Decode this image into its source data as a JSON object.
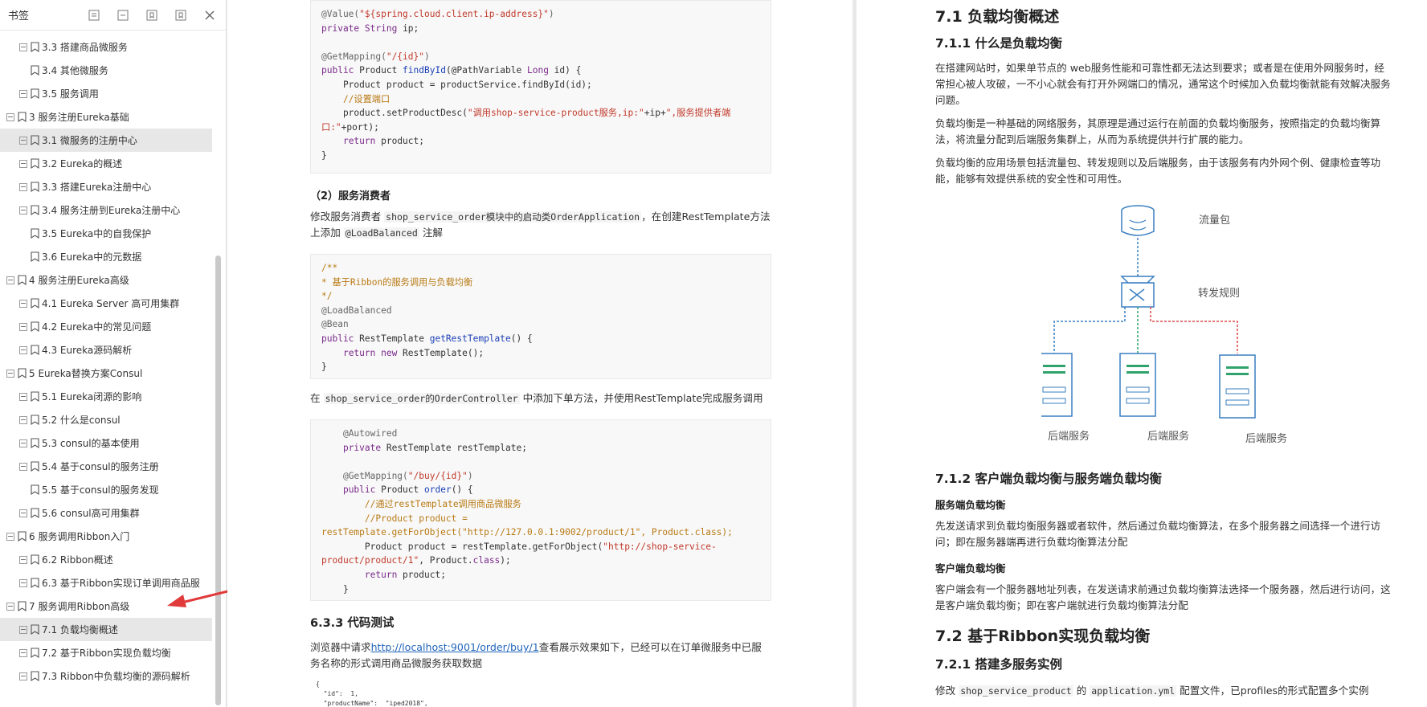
{
  "sidebar": {
    "title": "书签",
    "items": [
      {
        "label": "3.3 搭建商品微服务",
        "level": 2,
        "expand": true
      },
      {
        "label": "3.4 其他微服务",
        "level": 2,
        "expand": false
      },
      {
        "label": "3.5 服务调用",
        "level": 2,
        "expand": true
      },
      {
        "label": "3 服务注册Eureka基础",
        "level": 1,
        "expand": true
      },
      {
        "label": "3.1 微服务的注册中心",
        "level": 2,
        "expand": true,
        "selected": true
      },
      {
        "label": "3.2 Eureka的概述",
        "level": 2,
        "expand": true
      },
      {
        "label": "3.3 搭建Eureka注册中心",
        "level": 2,
        "expand": true
      },
      {
        "label": "3.4 服务注册到Eureka注册中心",
        "level": 2,
        "expand": true
      },
      {
        "label": "3.5 Eureka中的自我保护",
        "level": 2,
        "expand": false
      },
      {
        "label": "3.6 Eureka中的元数据",
        "level": 2,
        "expand": false
      },
      {
        "label": "4 服务注册Eureka高级",
        "level": 1,
        "expand": true
      },
      {
        "label": "4.1 Eureka Server 高可用集群",
        "level": 2,
        "expand": true
      },
      {
        "label": "4.2 Eureka中的常见问题",
        "level": 2,
        "expand": true
      },
      {
        "label": "4.3 Eureka源码解析",
        "level": 2,
        "expand": true
      },
      {
        "label": "5 Eureka替换方案Consul",
        "level": 1,
        "expand": true
      },
      {
        "label": "5.1 Eureka闭源的影响",
        "level": 2,
        "expand": true
      },
      {
        "label": "5.2 什么是consul",
        "level": 2,
        "expand": true
      },
      {
        "label": "5.3 consul的基本使用",
        "level": 2,
        "expand": true
      },
      {
        "label": "5.4 基于consul的服务注册",
        "level": 2,
        "expand": true
      },
      {
        "label": "5.5 基于consul的服务发现",
        "level": 2,
        "expand": false
      },
      {
        "label": "5.6 consul高可用集群",
        "level": 2,
        "expand": true
      },
      {
        "label": "6 服务调用Ribbon入门",
        "level": 1,
        "expand": true
      },
      {
        "label": "6.2 Ribbon概述",
        "level": 2,
        "expand": true
      },
      {
        "label": "6.3 基于Ribbon实现订单调用商品服",
        "level": 2,
        "expand": true
      },
      {
        "label": "7 服务调用Ribbon高级",
        "level": 1,
        "expand": true
      },
      {
        "label": "7.1 负载均衡概述",
        "level": 2,
        "expand": true,
        "selected": true
      },
      {
        "label": "7.2 基于Ribbon实现负载均衡",
        "level": 2,
        "expand": true
      },
      {
        "label": "7.3 Ribbon中负载均衡的源码解析",
        "level": 2,
        "expand": true
      }
    ]
  },
  "left": {
    "code1": [
      [
        "an",
        "@Value(\"${spring.cloud.client.ip-address}\")"
      ],
      [
        "kw",
        "private "
      ],
      [
        "",
        "String ip;"
      ],
      [
        "",
        ""
      ],
      [
        "an",
        "@GetMapping(\"/{id}\")"
      ],
      [
        "kw",
        "public "
      ],
      [
        "",
        "Product "
      ],
      [
        "fn",
        "findById"
      ],
      [
        "",
        "(@PathVariable Long id) {"
      ],
      [
        "",
        "    Product product = productService.findById(id);"
      ],
      [
        "cm",
        "    //设置端口"
      ],
      [
        "",
        "    product.setProductDesc(\"调用shop-service-product服务,ip:\"+ip+\",服务提供者端"
      ],
      [
        "",
        "口:\"+port);"
      ],
      [
        "kw",
        "    return "
      ],
      [
        "",
        "product;"
      ],
      [
        "",
        "}"
      ]
    ],
    "code1_lines": [
      "@Value(\"${spring.cloud.client.ip-address}\")",
      "private String ip;",
      "",
      "@GetMapping(\"/{id}\")",
      "public Product findById(@PathVariable Long id) {",
      "    Product product = productService.findById(id);",
      "    //设置端口",
      "    product.setProductDesc(\"调用shop-service-product服务,ip:\"+ip+\",服务提供者端",
      "口:\"+port);",
      "    return product;",
      "}"
    ],
    "h_consumer": "（2）服务消费者",
    "p_consumer_1": "修改服务消费者 ",
    "p_consumer_code": "shop_service_order模块中的启动类OrderApplication",
    "p_consumer_2": "，在创建RestTemplate方法上添加 ",
    "p_consumer_code2": "@LoadBalanced",
    "p_consumer_3": " 注解",
    "code2_lines": [
      "/**",
      "* 基于Ribbon的服务调用与负载均衡",
      "*/",
      "@LoadBalanced",
      "@Bean",
      "public RestTemplate getRestTemplate() {",
      "    return new RestTemplate();",
      "}"
    ],
    "p_order_1": "在 ",
    "p_order_code": "shop_service_order的OrderController",
    "p_order_2": " 中添加下单方法，并使用RestTemplate完成服务调用",
    "code3_lines": [
      "    @Autowired",
      "    private RestTemplate restTemplate;",
      "",
      "    @GetMapping(\"/buy/{id}\")",
      "    public Product order() {",
      "        //通过restTemplate调用商品微服务",
      "        //Product product =",
      "restTemplate.getForObject(\"http://127.0.0.1:9002/product/1\", Product.class);",
      "        Product product = restTemplate.getForObject(\"http://shop-service-",
      "product/product/1\", Product.class);",
      "        return product;",
      "    }"
    ],
    "h_test": "6.3.3 代码测试",
    "p_test_1": "浏览器中请求",
    "p_test_link": "http://localhost:9001/order/buy/1",
    "p_test_2": "查看展示效果如下，已经可以在订单微服务中已服务名称的形式调用商品微服务获取数据",
    "json_lines": [
      "{",
      "  \"id\":  1,",
      "  \"productName\":  \"iped2018\","
    ]
  },
  "right": {
    "h1": "7.1 负载均衡概述",
    "h2a": "7.1.1 什么是负载均衡",
    "p1": "在搭建网站时，如果单节点的 web服务性能和可靠性都无法达到要求；或者是在使用外网服务时，经常担心被人攻破，一不小心就会有打开外网端口的情况，通常这个时候加入负载均衡就能有效解决服务问题。",
    "p2": "负载均衡是一种基础的网络服务，其原理是通过运行在前面的负载均衡服务，按照指定的负载均衡算法，将流量分配到后端服务集群上，从而为系统提供并行扩展的能力。",
    "p3": "负载均衡的应用场景包括流量包、转发规则以及后端服务，由于该服务有内外网个例、健康检查等功能，能够有效提供系统的安全性和可用性。",
    "diagram": {
      "traffic": "流量包",
      "rule": "转发规则",
      "backend1": "后端服务",
      "backend2": "后端服务",
      "backend3": "后端服务",
      "blue": "#3a7fc1",
      "red": "#d94a4a",
      "green": "#2fa36b"
    },
    "h2b": "7.1.2 客户端负载均衡与服务端负载均衡",
    "h5a": "服务端负载均衡",
    "p4": "先发送请求到负载均衡服务器或者软件，然后通过负载均衡算法，在多个服务器之间选择一个进行访问；即在服务器端再进行负载均衡算法分配",
    "h5b": "客户端负载均衡",
    "p5": "客户端会有一个服务器地址列表，在发送请求前通过负载均衡算法选择一个服务器，然后进行访问，这是客户端负载均衡；即在客户端就进行负载均衡算法分配",
    "h1b": "7.2 基于Ribbon实现负载均衡",
    "h2c": "7.2.1 搭建多服务实例",
    "p6_1": "修改 ",
    "p6_code1": "shop_service_product",
    "p6_2": " 的 ",
    "p6_code2": "application.yml",
    "p6_3": " 配置文件，已profiles的形式配置多个实例"
  }
}
